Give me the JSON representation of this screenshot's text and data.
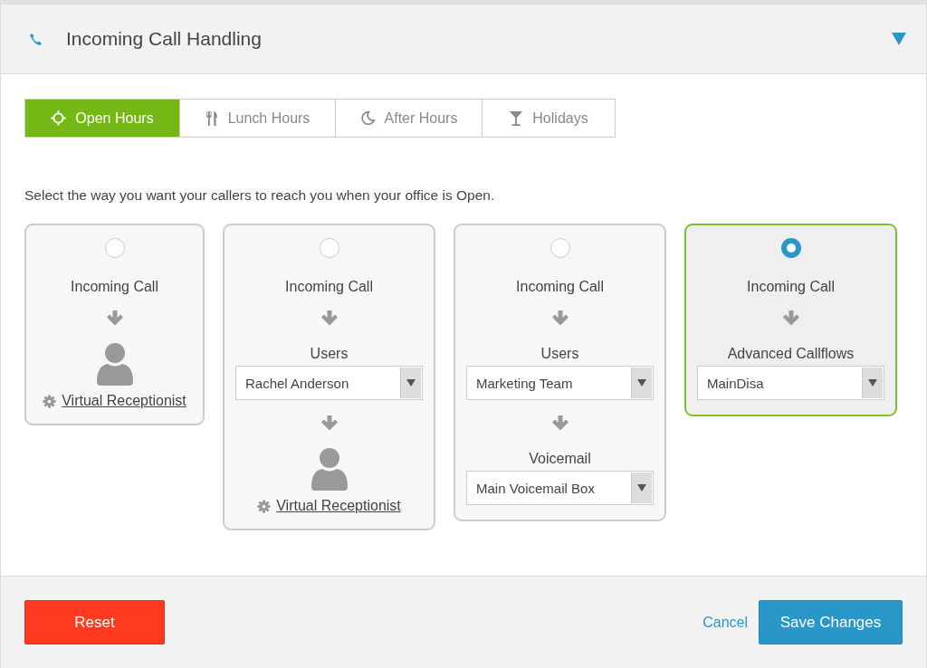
{
  "panel": {
    "title": "Incoming Call Handling",
    "expanded": true
  },
  "tabs": [
    {
      "label": "Open Hours",
      "selected": true
    },
    {
      "label": "Lunch Hours",
      "selected": false
    },
    {
      "label": "After Hours",
      "selected": false
    },
    {
      "label": "Holidays",
      "selected": false
    }
  ],
  "instruction": "Select the way you want your callers to reach you when your office is Open.",
  "options": [
    {
      "selected": false,
      "steps": [
        {
          "kind": "start",
          "label": "Incoming Call"
        },
        {
          "kind": "receptionist",
          "link": "Virtual Receptionist"
        }
      ]
    },
    {
      "selected": false,
      "steps": [
        {
          "kind": "start",
          "label": "Incoming Call"
        },
        {
          "kind": "select",
          "label": "Users",
          "value": "Rachel Anderson"
        },
        {
          "kind": "receptionist",
          "link": "Virtual Receptionist"
        }
      ]
    },
    {
      "selected": false,
      "steps": [
        {
          "kind": "start",
          "label": "Incoming Call"
        },
        {
          "kind": "select",
          "label": "Users",
          "value": "Marketing Team"
        },
        {
          "kind": "select",
          "label": "Voicemail",
          "value": "Main Voicemail Box"
        }
      ]
    },
    {
      "selected": true,
      "steps": [
        {
          "kind": "start",
          "label": "Incoming Call"
        },
        {
          "kind": "select",
          "label": "Advanced Callflows",
          "value": "MainDisa"
        }
      ]
    }
  ],
  "footer": {
    "reset": "Reset",
    "cancel": "Cancel",
    "save": "Save Changes"
  }
}
